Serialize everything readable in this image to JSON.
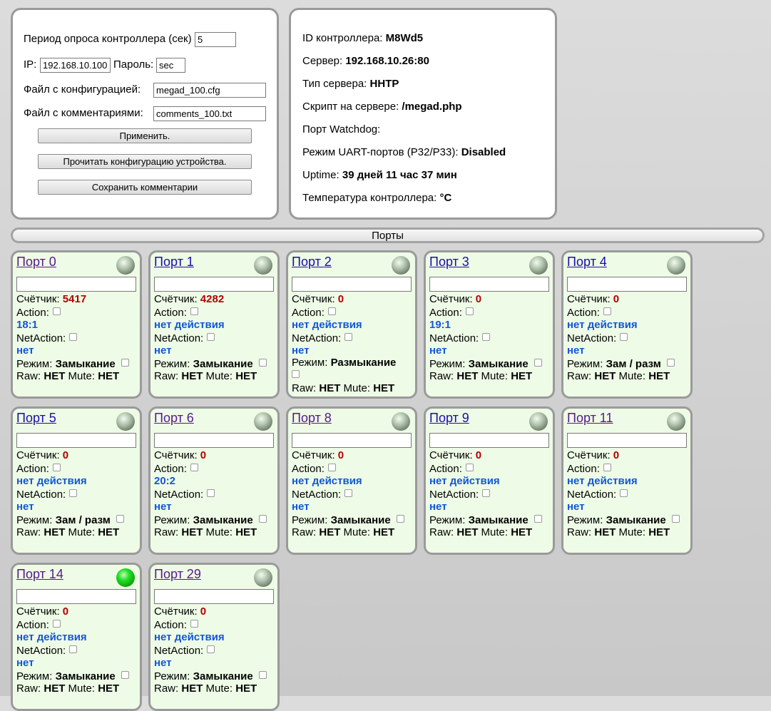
{
  "settings": {
    "poll_label": "Период опроса контроллера (сек)",
    "poll_value": "5",
    "ip_label": "IP:",
    "ip_value": "192.168.10.100",
    "pass_label": "Пароль:",
    "pass_value": "sec",
    "config_label": "Файл с конфигурацией:",
    "config_value": "megad_100.cfg",
    "comments_label": "Файл с комментариями:",
    "comments_value": "comments_100.txt",
    "apply_button": "Применить.",
    "read_button": "Прочитать конфигурацию устройства.",
    "save_button": "Сохранить комментарии"
  },
  "info": {
    "id_label": "ID контроллера:",
    "id_value": "M8Wd5",
    "server_label": "Сервер:",
    "server_value": "192.168.10.26:80",
    "type_label": "Тип сервера:",
    "type_value": "HHTP",
    "script_label": "Скрипт на сервере:",
    "script_value": "/megad.php",
    "watchdog_label": "Порт Watchdog:",
    "watchdog_value": "",
    "uart_label": "Режим UART-портов (P32/P33):",
    "uart_value": "Disabled",
    "uptime_label": "Uptime:",
    "uptime_value": "39 дней 11 час 37 мин",
    "temp_label": "Температура контроллера:",
    "temp_value": "°C"
  },
  "ports_header": "Порты",
  "labels": {
    "counter": "Счётчик:",
    "action": "Action:",
    "netaction": "NetAction:",
    "mode": "Режим:",
    "raw": "Raw:",
    "mute": "Mute:"
  },
  "ports": [
    {
      "title": "Порт 0",
      "counter": "5417",
      "action": "18:1",
      "netaction": "нет",
      "mode": "Замыкание",
      "raw": "НЕТ",
      "mute": "НЕТ",
      "led_on": false,
      "visited": true
    },
    {
      "title": "Порт 1",
      "counter": "4282",
      "action": "нет действия",
      "netaction": "нет",
      "mode": "Замыкание",
      "raw": "НЕТ",
      "mute": "НЕТ",
      "led_on": false,
      "visited": false
    },
    {
      "title": "Порт 2",
      "counter": "0",
      "action": "нет действия",
      "netaction": "нет",
      "mode": "Размыкание",
      "raw": "НЕТ",
      "mute": "НЕТ",
      "led_on": false,
      "visited": false
    },
    {
      "title": "Порт 3",
      "counter": "0",
      "action": "19:1",
      "netaction": "нет",
      "mode": "Замыкание",
      "raw": "НЕТ",
      "mute": "НЕТ",
      "led_on": false,
      "visited": false
    },
    {
      "title": "Порт 4",
      "counter": "0",
      "action": "нет действия",
      "netaction": "нет",
      "mode": "Зам / разм",
      "raw": "НЕТ",
      "mute": "НЕТ",
      "led_on": false,
      "visited": false
    },
    {
      "title": "Порт 5",
      "counter": "0",
      "action": "нет действия",
      "netaction": "нет",
      "mode": "Зам / разм",
      "raw": "НЕТ",
      "mute": "НЕТ",
      "led_on": false,
      "visited": false
    },
    {
      "title": "Порт 6",
      "counter": "0",
      "action": "20:2",
      "netaction": "нет",
      "mode": "Замыкание",
      "raw": "НЕТ",
      "mute": "НЕТ",
      "led_on": false,
      "visited": true
    },
    {
      "title": "Порт 8",
      "counter": "0",
      "action": "нет действия",
      "netaction": "нет",
      "mode": "Замыкание",
      "raw": "НЕТ",
      "mute": "НЕТ",
      "led_on": false,
      "visited": true
    },
    {
      "title": "Порт 9",
      "counter": "0",
      "action": "нет действия",
      "netaction": "нет",
      "mode": "Замыкание",
      "raw": "НЕТ",
      "mute": "НЕТ",
      "led_on": false,
      "visited": false
    },
    {
      "title": "Порт 11",
      "counter": "0",
      "action": "нет действия",
      "netaction": "нет",
      "mode": "Замыкание",
      "raw": "НЕТ",
      "mute": "НЕТ",
      "led_on": false,
      "visited": true
    },
    {
      "title": "Порт 14",
      "counter": "0",
      "action": "нет действия",
      "netaction": "нет",
      "mode": "Замыкание",
      "raw": "НЕТ",
      "mute": "НЕТ",
      "led_on": true,
      "visited": true
    },
    {
      "title": "Порт 29",
      "counter": "0",
      "action": "нет действия",
      "netaction": "нет",
      "mode": "Замыкание",
      "raw": "НЕТ",
      "mute": "НЕТ",
      "led_on": false,
      "visited": true
    }
  ]
}
